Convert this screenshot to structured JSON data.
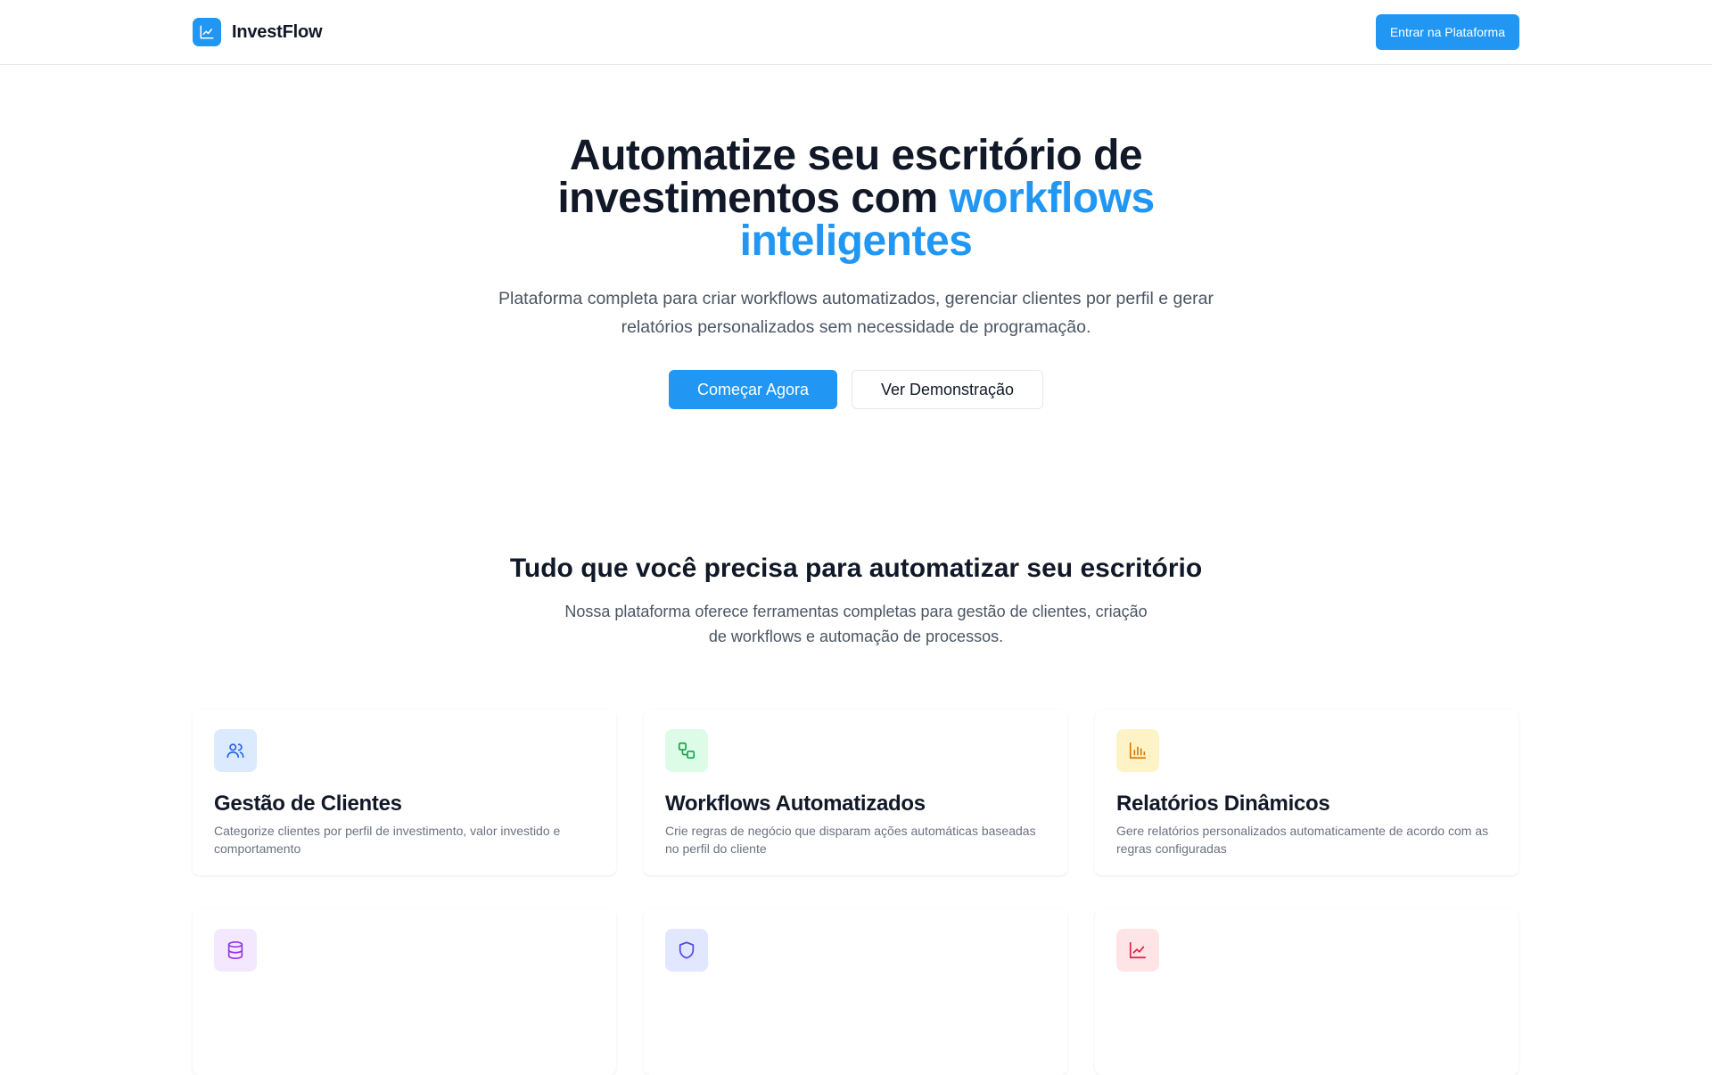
{
  "header": {
    "brand_name": "InvestFlow",
    "brand_icon": "line-chart-icon",
    "login_label": "Entrar na Plataforma"
  },
  "hero": {
    "title_main": "Automatize seu escritório de investimentos com",
    "title_accent": "workflows inteligentes",
    "subtitle": "Plataforma completa para criar workflows automatizados, gerenciar clientes por perfil e gerar relatórios personalizados sem necessidade de programação.",
    "primary_cta": "Começar Agora",
    "secondary_cta": "Ver Demonstração"
  },
  "features": {
    "heading": "Tudo que você precisa para automatizar seu escritório",
    "subheading": "Nossa plataforma oferece ferramentas completas para gestão de clientes, criação de workflows e automação de processos.",
    "cards": [
      {
        "title": "Gestão de Clientes",
        "description": "Categorize clientes por perfil de investimento, valor investido e comportamento",
        "icon": "users-icon",
        "bg": "#dbeafe",
        "fg": "#2563eb"
      },
      {
        "title": "Workflows Automatizados",
        "description": "Crie regras de negócio que disparam ações automáticas baseadas no perfil do cliente",
        "icon": "workflow-icon",
        "bg": "#dcfce7",
        "fg": "#16a34a"
      },
      {
        "title": "Relatórios Dinâmicos",
        "description": "Gere relatórios personalizados automaticamente de acordo com as regras configuradas",
        "icon": "bar-chart-icon",
        "bg": "#fef3c7",
        "fg": "#d97706"
      },
      {
        "title": "",
        "description": "",
        "icon": "database-icon",
        "bg": "#f3e8ff",
        "fg": "#9333ea"
      },
      {
        "title": "",
        "description": "",
        "icon": "shield-icon",
        "bg": "#e0e7ff",
        "fg": "#4f46e5"
      },
      {
        "title": "",
        "description": "",
        "icon": "trending-up-icon",
        "bg": "#ffe4e6",
        "fg": "#e11d48"
      }
    ]
  },
  "colors": {
    "accent": "#2196f3",
    "heading": "#111827",
    "body_text": "#4b5563"
  }
}
